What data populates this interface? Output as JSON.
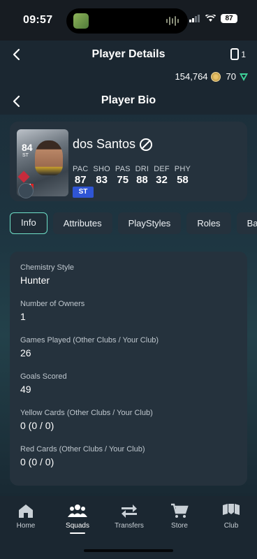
{
  "status_bar": {
    "time": "09:57",
    "battery": "87"
  },
  "header": {
    "title": "Player Details",
    "card_count": "1",
    "coins": "154,764",
    "points": "70"
  },
  "subheader": {
    "title": "Player Bio"
  },
  "player": {
    "name": "dos Santos",
    "card_rating": "84",
    "card_position": "ST",
    "position": "ST",
    "stats": [
      {
        "label": "PAC",
        "value": "87"
      },
      {
        "label": "SHO",
        "value": "83"
      },
      {
        "label": "PAS",
        "value": "75"
      },
      {
        "label": "DRI",
        "value": "88"
      },
      {
        "label": "DEF",
        "value": "32"
      },
      {
        "label": "PHY",
        "value": "58"
      }
    ]
  },
  "tabs": [
    {
      "label": "Info",
      "active": true
    },
    {
      "label": "Attributes"
    },
    {
      "label": "PlayStyles"
    },
    {
      "label": "Roles"
    },
    {
      "label": "Ba"
    }
  ],
  "info": [
    {
      "label": "Chemistry Style",
      "value": "Hunter"
    },
    {
      "label": "Number of Owners",
      "value": "1"
    },
    {
      "label": "Games Played (Other Clubs / Your Club)",
      "value": "26"
    },
    {
      "label": "Goals Scored",
      "value": "49"
    },
    {
      "label": "Yellow Cards (Other Clubs / Your Club)",
      "value": "0 (0 / 0)"
    },
    {
      "label": "Red Cards (Other Clubs / Your Club)",
      "value": "0 (0 / 0)"
    }
  ],
  "bottom_nav": [
    {
      "label": "Home",
      "icon": "home-icon"
    },
    {
      "label": "Squads",
      "icon": "squads-icon",
      "active": true
    },
    {
      "label": "Transfers",
      "icon": "transfers-icon"
    },
    {
      "label": "Store",
      "icon": "store-icon"
    },
    {
      "label": "Club",
      "icon": "club-icon"
    }
  ],
  "colors": {
    "accent": "#6fe1c8",
    "position_badge": "#2f55d4",
    "panel": "#25323d"
  }
}
